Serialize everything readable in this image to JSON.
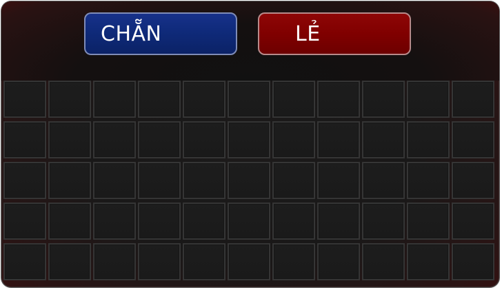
{
  "buttons": {
    "even_label": "CHẴN",
    "odd_label": "LẺ"
  },
  "board": {
    "rows": 5,
    "cols": 11,
    "cells_filled": []
  },
  "colors": {
    "even_button": "#0f2a7a",
    "odd_button": "#800000",
    "board_background": "#1b1b1b",
    "grid_line": "#353535"
  }
}
